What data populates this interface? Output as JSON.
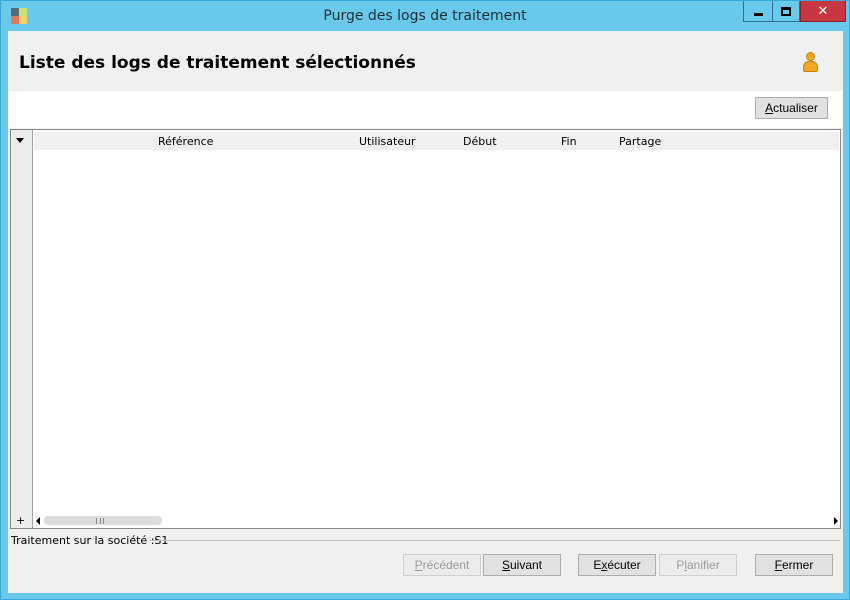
{
  "window": {
    "title": "Purge des logs de traitement",
    "close_glyph": "✕"
  },
  "header": {
    "page_title": "Liste des logs de traitement sélectionnés"
  },
  "toolbar": {
    "refresh_first": "A",
    "refresh_rest": "ctualiser"
  },
  "grid": {
    "columns": [
      "Référence",
      "Utilisateur",
      "Début",
      "Fin",
      "Partage"
    ],
    "add_row_glyph": "+",
    "rows": []
  },
  "status": {
    "text": "Traitement sur la société :S1"
  },
  "footer": {
    "prev": {
      "first": "P",
      "rest": "récédent"
    },
    "next": {
      "first": "S",
      "rest": "uivant"
    },
    "exec": {
      "pre": "E",
      "mid": "x",
      "post": "écuter"
    },
    "plan": {
      "pre": "P",
      "mid": "l",
      "post": "anifier"
    },
    "close": {
      "first": "F",
      "rest": "ermer"
    }
  },
  "colors": {
    "titlebar": "#69c9ea",
    "close_button": "#c7373f",
    "client_bg": "#f0f0f0",
    "user_icon": "#f5a623"
  },
  "icons": {
    "app": "app-icon",
    "user": "user-icon",
    "minimize": "minimize-icon",
    "maximize": "maximize-icon",
    "close": "close-icon"
  }
}
